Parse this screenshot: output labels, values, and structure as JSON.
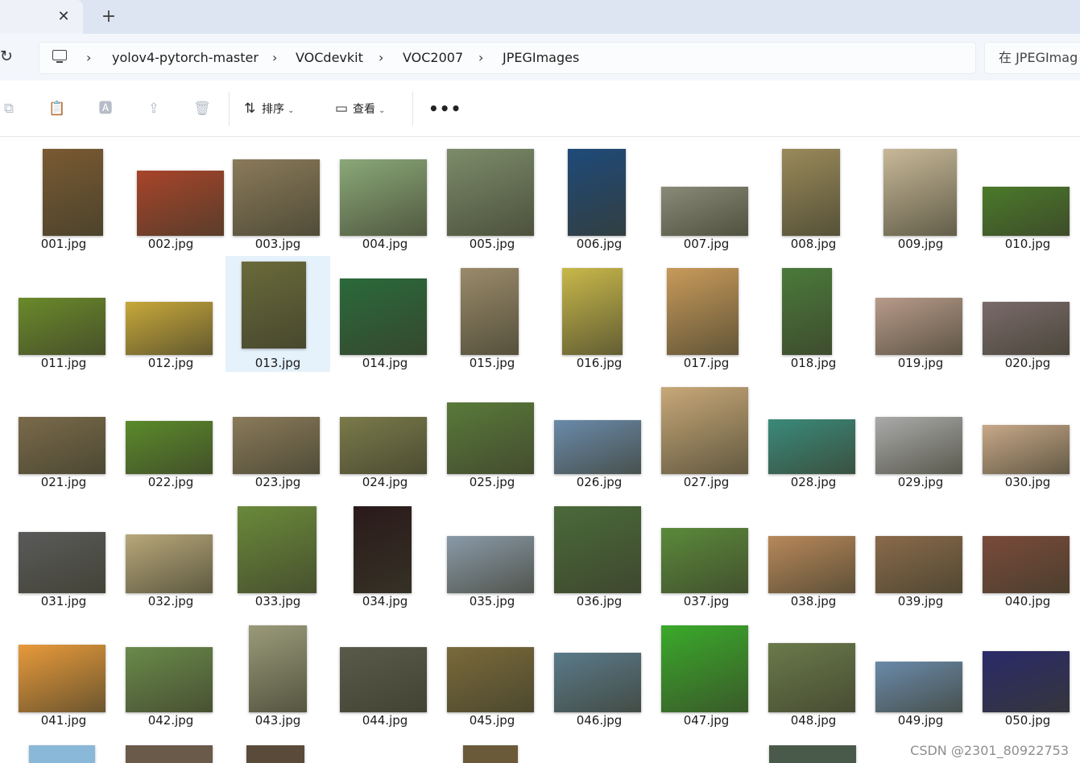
{
  "window": {
    "tab_close": "✕",
    "new_tab": "+"
  },
  "address": {
    "refresh": "↻",
    "crumbs": [
      "yolov4-pytorch-master",
      "VOCdevkit",
      "VOC2007",
      "JPEGImages"
    ],
    "chevron": "›",
    "search_text": "在 JPEGImag"
  },
  "commands": {
    "sort_label": "排序",
    "view_label": "查看",
    "more": "•••",
    "chevron": "⌄"
  },
  "icons": {
    "copy": "⧉",
    "paste": "📋",
    "rename": "🅰",
    "share": "⇪",
    "delete": "🗑",
    "sort": "⇅",
    "view": "▭"
  },
  "files": [
    {
      "name": "001.jpg",
      "color": "#7a5a32"
    },
    {
      "name": "002.jpg",
      "color": "#a8442a"
    },
    {
      "name": "003.jpg",
      "color": "#8a7a5a"
    },
    {
      "name": "004.jpg",
      "color": "#8aa878"
    },
    {
      "name": "005.jpg",
      "color": "#7c8c6a"
    },
    {
      "name": "006.jpg",
      "color": "#1e4a7a"
    },
    {
      "name": "007.jpg",
      "color": "#8a8a78"
    },
    {
      "name": "008.jpg",
      "color": "#9a8a5a"
    },
    {
      "name": "009.jpg",
      "color": "#c8b898"
    },
    {
      "name": "010.jpg",
      "color": "#4a7a2a"
    },
    {
      "name": "011.jpg",
      "color": "#6a8a2a"
    },
    {
      "name": "012.jpg",
      "color": "#c8a83a"
    },
    {
      "name": "013.jpg",
      "color": "#6a6a3a"
    },
    {
      "name": "014.jpg",
      "color": "#2a6a3a"
    },
    {
      "name": "015.jpg",
      "color": "#9a8a6a"
    },
    {
      "name": "016.jpg",
      "color": "#c8b84a"
    },
    {
      "name": "017.jpg",
      "color": "#c89a5a"
    },
    {
      "name": "018.jpg",
      "color": "#4a7a3a"
    },
    {
      "name": "019.jpg",
      "color": "#b89a8a"
    },
    {
      "name": "020.jpg",
      "color": "#7a6a6a"
    },
    {
      "name": "021.jpg",
      "color": "#7a6a4a"
    },
    {
      "name": "022.jpg",
      "color": "#5a8a2a"
    },
    {
      "name": "023.jpg",
      "color": "#8a7a5a"
    },
    {
      "name": "024.jpg",
      "color": "#7a7a4a"
    },
    {
      "name": "025.jpg",
      "color": "#5a7a3a"
    },
    {
      "name": "026.jpg",
      "color": "#6a8aaa"
    },
    {
      "name": "027.jpg",
      "color": "#c8a878"
    },
    {
      "name": "028.jpg",
      "color": "#3a8a7a"
    },
    {
      "name": "029.jpg",
      "color": "#aaaaaa"
    },
    {
      "name": "030.jpg",
      "color": "#c8a888"
    },
    {
      "name": "031.jpg",
      "color": "#5a5a5a"
    },
    {
      "name": "032.jpg",
      "color": "#b8a87a"
    },
    {
      "name": "033.jpg",
      "color": "#6a8a3a"
    },
    {
      "name": "034.jpg",
      "color": "#2a1a1a"
    },
    {
      "name": "035.jpg",
      "color": "#8a9aa8"
    },
    {
      "name": "036.jpg",
      "color": "#4a6a3a"
    },
    {
      "name": "037.jpg",
      "color": "#5a8a3a"
    },
    {
      "name": "038.jpg",
      "color": "#b8885a"
    },
    {
      "name": "039.jpg",
      "color": "#8a6a4a"
    },
    {
      "name": "040.jpg",
      "color": "#7a4a3a"
    },
    {
      "name": "041.jpg",
      "color": "#e89a3a"
    },
    {
      "name": "042.jpg",
      "color": "#6a8a4a"
    },
    {
      "name": "043.jpg",
      "color": "#9a9a7a"
    },
    {
      "name": "044.jpg",
      "color": "#5a5a4a"
    },
    {
      "name": "045.jpg",
      "color": "#7a6a3a"
    },
    {
      "name": "046.jpg",
      "color": "#5a7a8a"
    },
    {
      "name": "047.jpg",
      "color": "#3aaa2a"
    },
    {
      "name": "048.jpg",
      "color": "#6a7a4a"
    },
    {
      "name": "049.jpg",
      "color": "#6a8aaa"
    },
    {
      "name": "050.jpg",
      "color": "#2a2a6a"
    }
  ],
  "partial_row_colors": [
    "#8ab8d8",
    "#6a5a4a",
    "#5a4a3a",
    "#6a5a3a",
    "#4a5a4a"
  ],
  "selected_index": 12,
  "watermark": "CSDN @2301_80922753"
}
